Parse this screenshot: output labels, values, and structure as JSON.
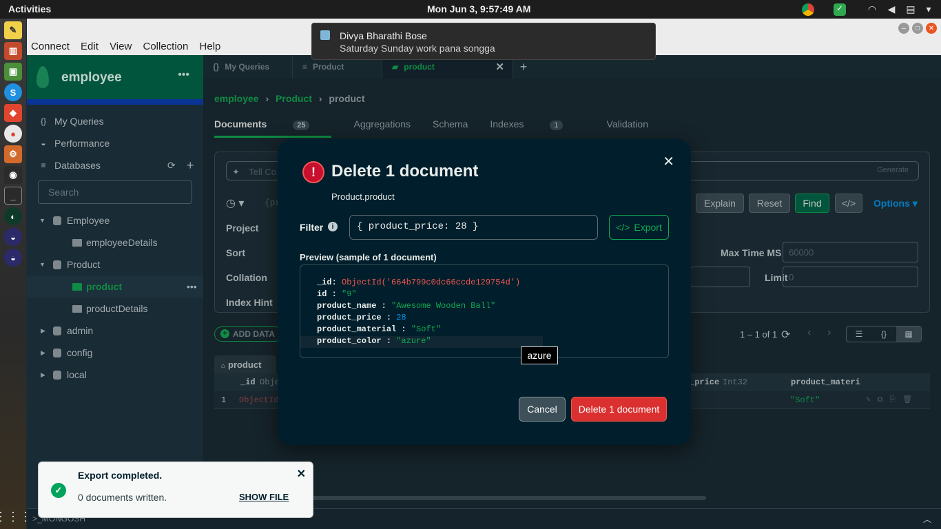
{
  "system": {
    "activities": "Activities",
    "clock": "Mon Jun  3,  9:57:49 AM"
  },
  "notification": {
    "sender": "Divya Bharathi Bose",
    "message": "Saturday Sunday work pana songga"
  },
  "menu": [
    "Connect",
    "Edit",
    "View",
    "Collection",
    "Help"
  ],
  "sidebar": {
    "connection_name": "employee",
    "my_queries": "My Queries",
    "performance": "Performance",
    "databases": "Databases",
    "search_placeholder": "Search",
    "tree": [
      {
        "label": "Employee",
        "type": "db"
      },
      {
        "label": "employeeDetails",
        "type": "coll"
      },
      {
        "label": "Product",
        "type": "db"
      },
      {
        "label": "product",
        "type": "coll",
        "selected": true
      },
      {
        "label": "productDetails",
        "type": "coll"
      },
      {
        "label": "admin",
        "type": "db"
      },
      {
        "label": "config",
        "type": "db"
      },
      {
        "label": "local",
        "type": "db"
      }
    ]
  },
  "tabs": [
    {
      "label": "My Queries",
      "icon": "braces-icon"
    },
    {
      "label": "Product",
      "icon": "database-icon"
    },
    {
      "label": "product",
      "icon": "folder-icon",
      "active": true
    }
  ],
  "breadcrumb": {
    "a": "employee",
    "b": "Product",
    "c": "product"
  },
  "subtabs": {
    "documents": "Documents",
    "documents_count": "25",
    "aggregations": "Aggregations",
    "schema": "Schema",
    "indexes": "Indexes",
    "indexes_count": "1",
    "validation": "Validation"
  },
  "query": {
    "ai_placeholder": "Tell Co",
    "generate": "Generate",
    "filter_prefix": "{pr",
    "explain": "Explain",
    "reset": "Reset",
    "find": "Find",
    "options": "Options",
    "project": "Project",
    "sort": "Sort",
    "collation": "Collation",
    "index_hint": "Index Hint",
    "max_time_label": "Max Time MS",
    "max_time_placeholder": "60000",
    "limit_label": "Limit",
    "limit_placeholder": "0"
  },
  "results": {
    "add_data": "ADD DATA",
    "pagination": "1 – 1 of 1",
    "table_tab": "product",
    "col_id": "_id",
    "col_id_type": "Obje",
    "col_price": "_price",
    "col_price_type": "Int32",
    "col_material": "product_materi",
    "row_num": "1",
    "row_id": "ObjectId",
    "row_material": "\"Soft\""
  },
  "shell": {
    "label": ">_MONGOSH"
  },
  "modal": {
    "title": "Delete 1 document",
    "namespace": "Product.product",
    "filter_label": "Filter",
    "filter_value": "{ product_price: 28 }",
    "export_label": "Export",
    "preview_label": "Preview (sample of 1 document)",
    "preview": {
      "id_key": "_id",
      "id_val": "ObjectId('664b799c0dc66ccde129754d')",
      "id2_key": "id",
      "id2_val": "\"9\"",
      "name_key": "product_name",
      "name_val": "\"Awesome Wooden Ball\"",
      "price_key": "product_price",
      "price_val": "28",
      "material_key": "product_material",
      "material_val": "\"Soft\"",
      "color_key": "product_color",
      "color_val": "\"azure\""
    },
    "tooltip": "azure",
    "cancel": "Cancel",
    "delete": "Delete 1 document"
  },
  "toast": {
    "title": "Export completed.",
    "body": "0 documents written.",
    "action": "SHOW FILE"
  },
  "colors": {
    "accent_green": "#13aa52",
    "danger_red": "#db3030",
    "sidebar_header": "#00684a",
    "modal_bg": "#001e2b"
  }
}
